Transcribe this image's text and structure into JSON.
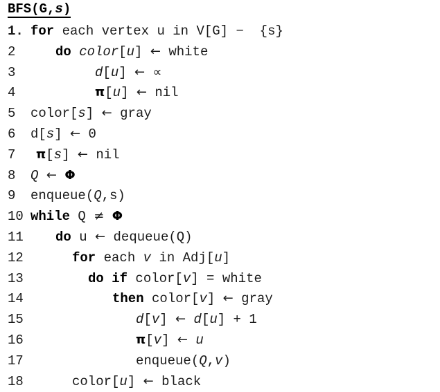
{
  "heading": {
    "prefix": "BFS(G,",
    "italic_arg": "s",
    "suffix": ")",
    "full_text": "BFS(G,s)"
  },
  "lines": [
    {
      "number": "1.",
      "number_bold": true,
      "indent": 44,
      "text": "for each vertex u in V[G] −  {s}",
      "parts": [
        {
          "t": "for",
          "style": "kw"
        },
        {
          "t": " each vertex u in V[G] ",
          "style": "plain"
        },
        {
          "t": "−",
          "style": "plain"
        },
        {
          "t": "  {s}",
          "style": "plain"
        }
      ]
    },
    {
      "number": "2",
      "number_bold": false,
      "indent": 80,
      "text": "do color[u] ← white",
      "parts": [
        {
          "t": "do",
          "style": "kw"
        },
        {
          "t": " ",
          "style": "plain"
        },
        {
          "t": "color",
          "style": "it"
        },
        {
          "t": "[",
          "style": "plain"
        },
        {
          "t": "u",
          "style": "it"
        },
        {
          "t": "] ",
          "style": "plain"
        },
        {
          "t": "←",
          "style": "arr"
        },
        {
          "t": " white",
          "style": "plain"
        }
      ]
    },
    {
      "number": "3",
      "number_bold": false,
      "indent": 137,
      "text": "d[u] ← ∝",
      "parts": [
        {
          "t": "d",
          "style": "it"
        },
        {
          "t": "[",
          "style": "plain"
        },
        {
          "t": "u",
          "style": "it"
        },
        {
          "t": "] ",
          "style": "plain"
        },
        {
          "t": "←",
          "style": "arr"
        },
        {
          "t": " ",
          "style": "plain"
        },
        {
          "t": "∝",
          "style": "inf"
        }
      ]
    },
    {
      "number": "4",
      "number_bold": false,
      "indent": 137,
      "text": "π[u] ← nil",
      "parts": [
        {
          "t": "π",
          "style": "sym"
        },
        {
          "t": "[",
          "style": "plain"
        },
        {
          "t": "u",
          "style": "it"
        },
        {
          "t": "] ",
          "style": "plain"
        },
        {
          "t": "←",
          "style": "arr"
        },
        {
          "t": " nil",
          "style": "plain"
        }
      ]
    },
    {
      "number": "5",
      "number_bold": false,
      "indent": 44,
      "text": "color[s] ← gray",
      "parts": [
        {
          "t": "color[",
          "style": "plain"
        },
        {
          "t": "s",
          "style": "it"
        },
        {
          "t": "] ",
          "style": "plain"
        },
        {
          "t": "←",
          "style": "arr"
        },
        {
          "t": " gray",
          "style": "plain"
        }
      ]
    },
    {
      "number": "6",
      "number_bold": false,
      "indent": 44,
      "text": "d[s] ← 0",
      "parts": [
        {
          "t": "d[",
          "style": "plain"
        },
        {
          "t": "s",
          "style": "it"
        },
        {
          "t": "] ",
          "style": "plain"
        },
        {
          "t": "←",
          "style": "arr"
        },
        {
          "t": " 0",
          "style": "plain"
        }
      ]
    },
    {
      "number": "7",
      "number_bold": false,
      "indent": 52,
      "text": "π[s] ← nil",
      "parts": [
        {
          "t": "π",
          "style": "sym"
        },
        {
          "t": "[",
          "style": "plain"
        },
        {
          "t": "s",
          "style": "it"
        },
        {
          "t": "] ",
          "style": "plain"
        },
        {
          "t": "←",
          "style": "arr"
        },
        {
          "t": " nil",
          "style": "plain"
        }
      ]
    },
    {
      "number": "8",
      "number_bold": false,
      "indent": 44,
      "text": "Q ← Φ",
      "parts": [
        {
          "t": "Q",
          "style": "it"
        },
        {
          "t": " ",
          "style": "plain"
        },
        {
          "t": "←",
          "style": "arr"
        },
        {
          "t": " ",
          "style": "plain"
        },
        {
          "t": "Φ",
          "style": "sym"
        }
      ]
    },
    {
      "number": "9",
      "number_bold": false,
      "indent": 44,
      "text": "enqueue(Q,s)",
      "parts": [
        {
          "t": "enqueue(",
          "style": "plain"
        },
        {
          "t": "Q",
          "style": "it"
        },
        {
          "t": ",s)",
          "style": "plain"
        }
      ]
    },
    {
      "number": "10",
      "number_bold": false,
      "indent": 44,
      "text": "while Q ≠ Φ",
      "parts": [
        {
          "t": "while",
          "style": "kw"
        },
        {
          "t": " Q ",
          "style": "plain"
        },
        {
          "t": "≠",
          "style": "ne"
        },
        {
          "t": " ",
          "style": "plain"
        },
        {
          "t": "Φ",
          "style": "sym"
        }
      ]
    },
    {
      "number": "11",
      "number_bold": false,
      "indent": 80,
      "text": "do u ← dequeue(Q)",
      "parts": [
        {
          "t": "do",
          "style": "kw"
        },
        {
          "t": " u ",
          "style": "plain"
        },
        {
          "t": "←",
          "style": "arr"
        },
        {
          "t": " dequeue(Q)",
          "style": "plain"
        }
      ]
    },
    {
      "number": "12",
      "number_bold": false,
      "indent": 104,
      "text": "for each v in Adj[u]",
      "parts": [
        {
          "t": "for",
          "style": "kw"
        },
        {
          "t": " each ",
          "style": "plain"
        },
        {
          "t": "v",
          "style": "it"
        },
        {
          "t": " in Adj[",
          "style": "plain"
        },
        {
          "t": "u",
          "style": "it"
        },
        {
          "t": "]",
          "style": "plain"
        }
      ]
    },
    {
      "number": "13",
      "number_bold": false,
      "indent": 127,
      "text": "do if color[v] = white",
      "parts": [
        {
          "t": "do if",
          "style": "kw"
        },
        {
          "t": " color[",
          "style": "plain"
        },
        {
          "t": "v",
          "style": "it"
        },
        {
          "t": "] = white",
          "style": "plain"
        }
      ]
    },
    {
      "number": "14",
      "number_bold": false,
      "indent": 162,
      "text": "then color[v] ← gray",
      "parts": [
        {
          "t": "then",
          "style": "kw"
        },
        {
          "t": " color[",
          "style": "plain"
        },
        {
          "t": "v",
          "style": "it"
        },
        {
          "t": "] ",
          "style": "plain"
        },
        {
          "t": "←",
          "style": "arr"
        },
        {
          "t": " gray",
          "style": "plain"
        }
      ]
    },
    {
      "number": "15",
      "number_bold": false,
      "indent": 196,
      "text": "d[v] ← d[u] + 1",
      "parts": [
        {
          "t": "d",
          "style": "it"
        },
        {
          "t": "[",
          "style": "plain"
        },
        {
          "t": "v",
          "style": "it"
        },
        {
          "t": "] ",
          "style": "plain"
        },
        {
          "t": "←",
          "style": "arr"
        },
        {
          "t": " ",
          "style": "plain"
        },
        {
          "t": "d",
          "style": "it"
        },
        {
          "t": "[",
          "style": "plain"
        },
        {
          "t": "u",
          "style": "it"
        },
        {
          "t": "] + 1",
          "style": "plain"
        }
      ]
    },
    {
      "number": "16",
      "number_bold": false,
      "indent": 196,
      "text": "π[v] ← u",
      "parts": [
        {
          "t": "π",
          "style": "sym"
        },
        {
          "t": "[",
          "style": "plain"
        },
        {
          "t": "v",
          "style": "it"
        },
        {
          "t": "] ",
          "style": "plain"
        },
        {
          "t": "←",
          "style": "arr"
        },
        {
          "t": " ",
          "style": "plain"
        },
        {
          "t": "u",
          "style": "it"
        }
      ]
    },
    {
      "number": "17",
      "number_bold": false,
      "indent": 196,
      "text": "enqueue(Q,v)",
      "parts": [
        {
          "t": "enqueue(",
          "style": "plain"
        },
        {
          "t": "Q",
          "style": "it"
        },
        {
          "t": ",",
          "style": "plain"
        },
        {
          "t": "v",
          "style": "it"
        },
        {
          "t": ")",
          "style": "plain"
        }
      ]
    },
    {
      "number": "18",
      "number_bold": false,
      "indent": 104,
      "text": "color[u] ← black",
      "parts": [
        {
          "t": "color[",
          "style": "plain"
        },
        {
          "t": "u",
          "style": "it"
        },
        {
          "t": "] ",
          "style": "plain"
        },
        {
          "t": "←",
          "style": "arr"
        },
        {
          "t": " black",
          "style": "plain"
        }
      ]
    }
  ],
  "colors": {
    "text": "#1a1a1a",
    "emphasis": "#000000",
    "background": "#ffffff"
  }
}
